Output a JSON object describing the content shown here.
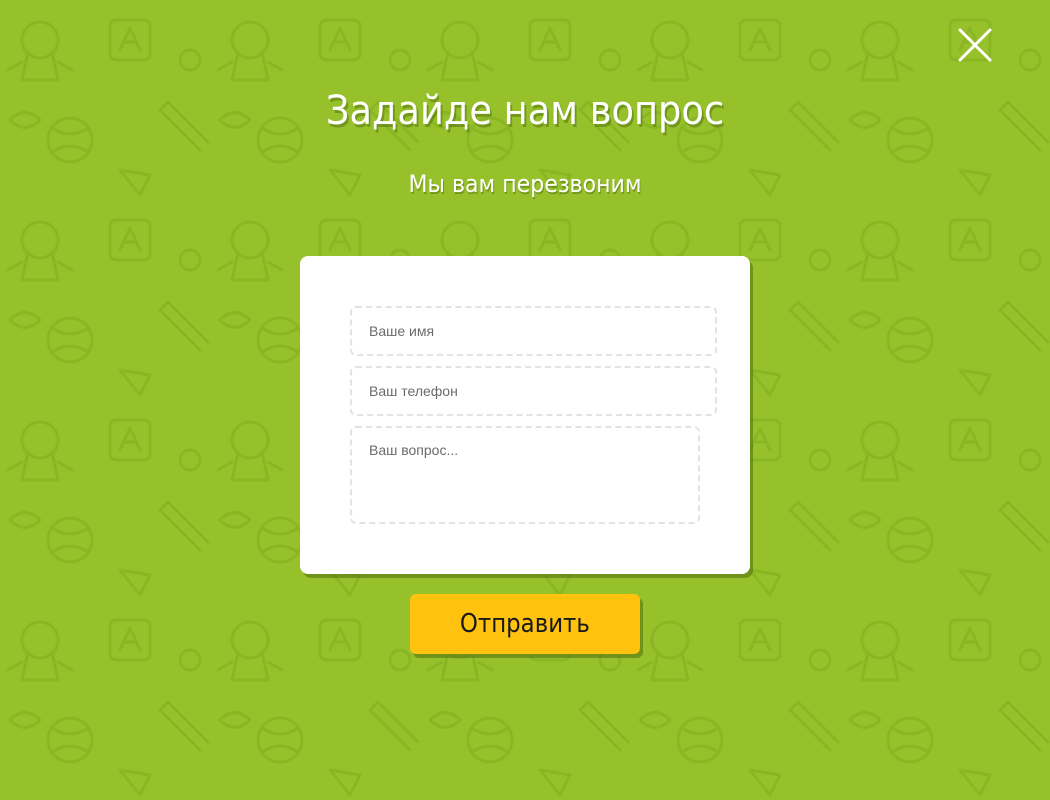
{
  "modal": {
    "title": "Задайде нам вопрос",
    "subtitle": "Мы вам перезвоним",
    "close_icon": "close-icon"
  },
  "form": {
    "name_placeholder": "Ваше имя",
    "name_value": "",
    "phone_placeholder": "Ваш телефон",
    "phone_value": "",
    "question_placeholder": "Ваш вопрос...",
    "question_value": "",
    "submit_label": "Отправить"
  },
  "colors": {
    "background": "#97c12b",
    "card": "#ffffff",
    "button": "#ffc20e",
    "field_border": "#e3e3e3"
  }
}
